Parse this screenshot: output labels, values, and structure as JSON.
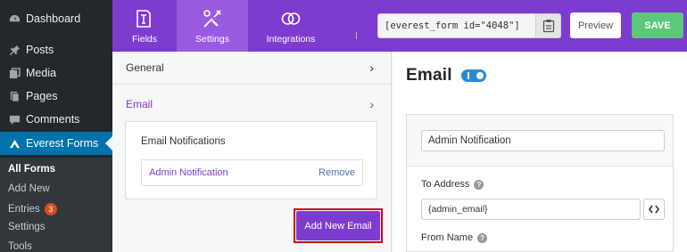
{
  "wp_menu": {
    "items": [
      {
        "label": "Dashboard",
        "icon": "dashboard-icon"
      },
      {
        "label": "Posts",
        "icon": "pin-icon"
      },
      {
        "label": "Media",
        "icon": "media-icon"
      },
      {
        "label": "Pages",
        "icon": "pages-icon"
      },
      {
        "label": "Comments",
        "icon": "comment-icon"
      },
      {
        "label": "Everest Forms",
        "icon": "everest-forms-icon"
      }
    ],
    "submenu": [
      {
        "label": "All Forms"
      },
      {
        "label": "Add New"
      },
      {
        "label": "Entries",
        "badge": "3"
      },
      {
        "label": "Settings"
      },
      {
        "label": "Tools"
      }
    ]
  },
  "header": {
    "tabs": [
      {
        "label": "Fields",
        "icon": "fields-icon"
      },
      {
        "label": "Settings",
        "icon": "settings-tools-icon"
      },
      {
        "label": "Integrations",
        "icon": "integrations-icon"
      }
    ],
    "shortcode": "[everest_form id=\"4048\"]",
    "preview_label": "Preview",
    "save_label": "SAVE"
  },
  "left_panel": {
    "general_label": "General",
    "email_label": "Email",
    "notifications_title": "Email Notifications",
    "notification_item": "Admin Notification",
    "remove_label": "Remove",
    "add_new_label": "Add New Email"
  },
  "right_panel": {
    "heading": "Email",
    "notification_name": "Admin Notification",
    "to_address_label": "To Address",
    "to_address_value": "{admin_email}",
    "from_name_label": "From Name"
  },
  "colors": {
    "accent": "#7e3bd0",
    "save": "#5cc87a",
    "wp_current": "#0073aa",
    "highlight": "#d0021b"
  }
}
